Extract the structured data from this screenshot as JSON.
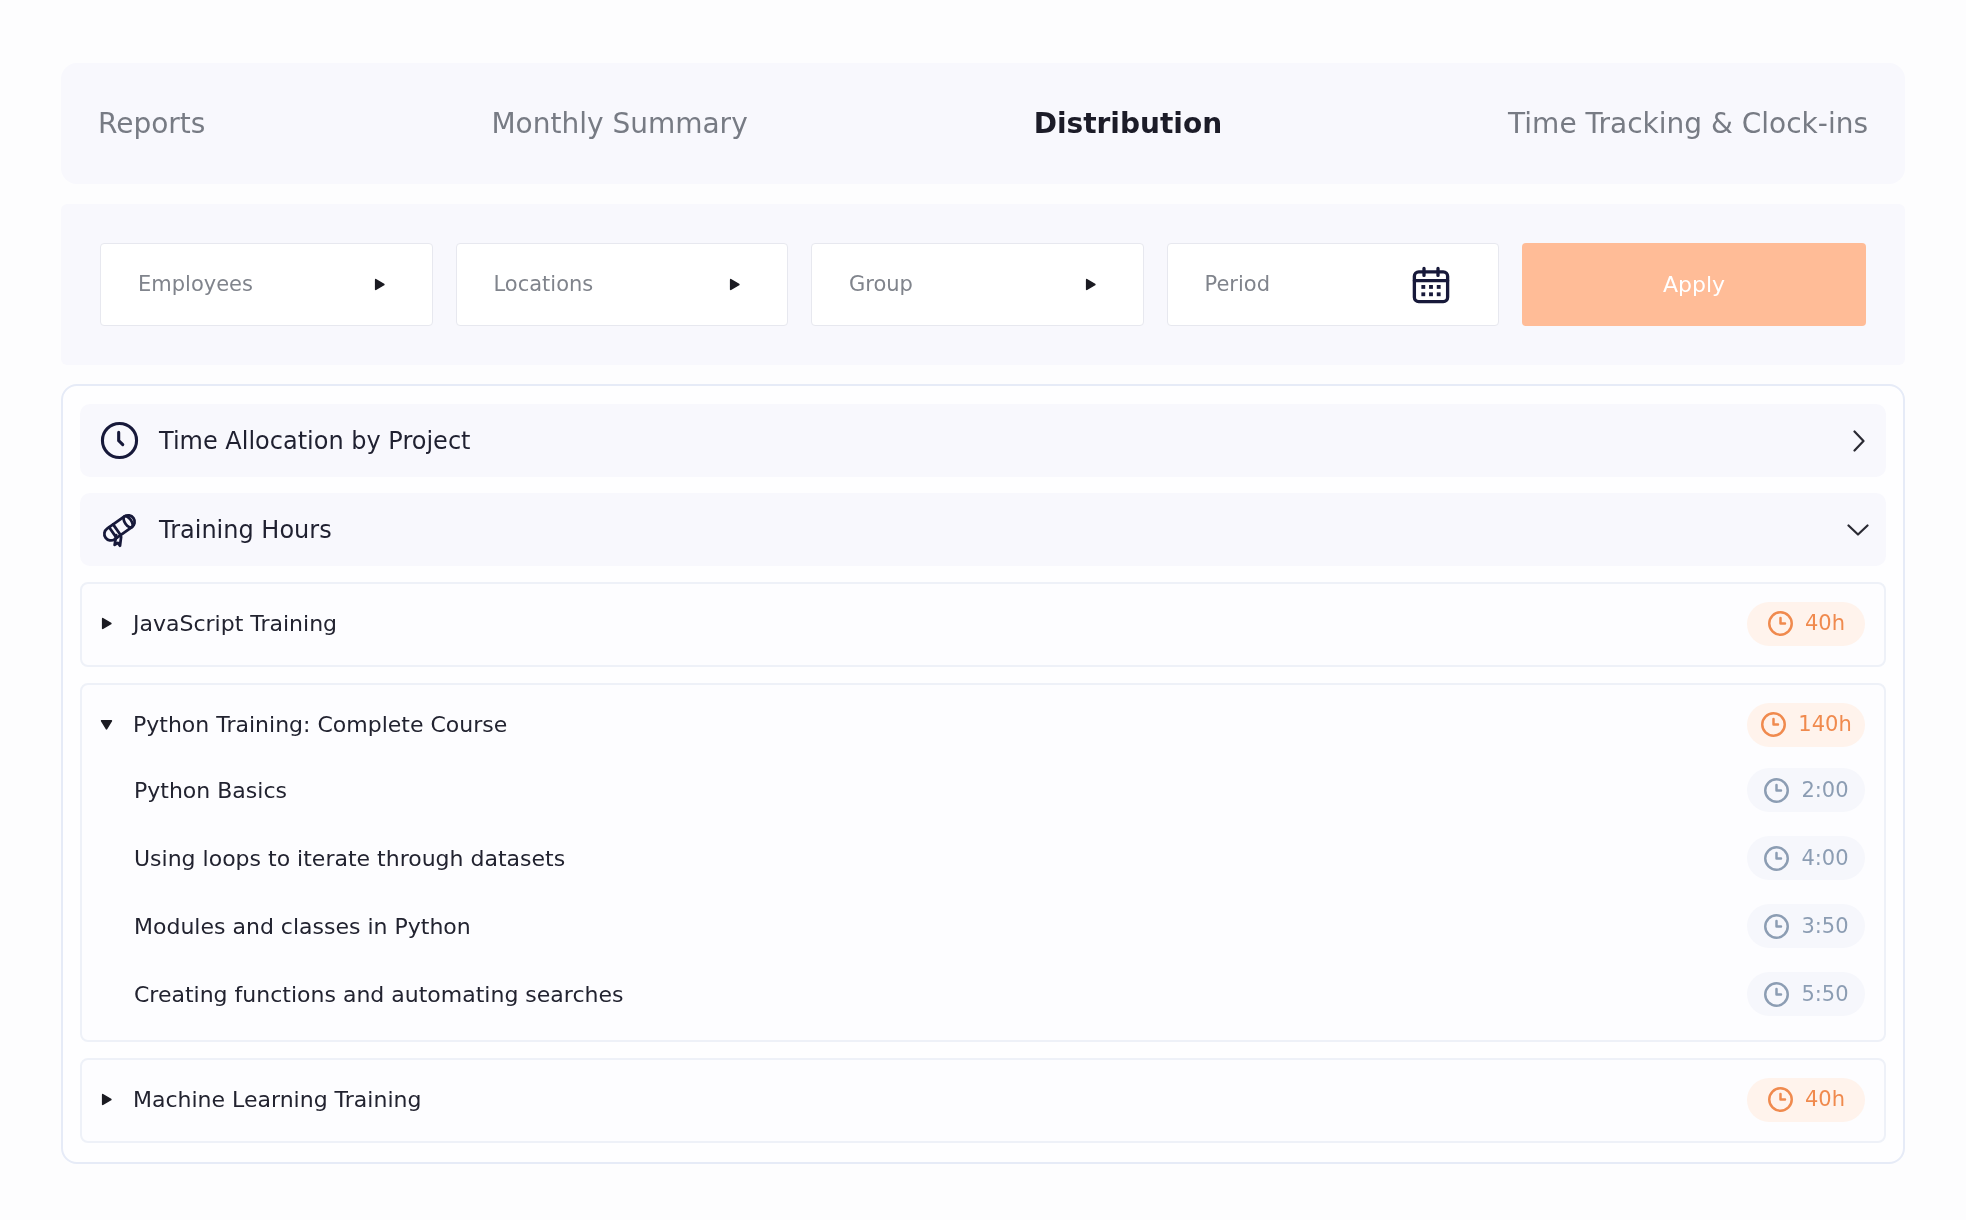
{
  "tabs": [
    {
      "label": "Reports",
      "selected": false
    },
    {
      "label": "Monthly Summary",
      "selected": false
    },
    {
      "label": "Distribution",
      "selected": true
    },
    {
      "label": "Time Tracking & Clock-ins",
      "selected": false
    }
  ],
  "filters": [
    {
      "kind": "dropdown",
      "placeholder": "Employees"
    },
    {
      "kind": "dropdown",
      "placeholder": "Locations"
    },
    {
      "kind": "dropdown",
      "placeholder": "Group"
    },
    {
      "kind": "date",
      "placeholder": "Period"
    }
  ],
  "apply_button": {
    "label": "Apply"
  },
  "sections": [
    {
      "kind": "project",
      "title": "Time Allocation by Project",
      "expanded": false
    },
    {
      "kind": "training",
      "title": "Training Hours",
      "expanded": true,
      "items": [
        {
          "title": "JavaScript Training",
          "hours": "40h",
          "expanded": false
        },
        {
          "title": "Python Training: Complete Course",
          "hours": "140h",
          "expanded": true,
          "children": [
            {
              "title": "Python Basics",
              "duration": "2:00"
            },
            {
              "title": "Using loops to iterate through datasets",
              "duration": "4:00"
            },
            {
              "title": "Modules and classes in Python",
              "duration": "3:50"
            },
            {
              "title": "Creating functions and automating searches",
              "duration": "5:50"
            }
          ]
        },
        {
          "title": "Machine Learning Training",
          "hours": "40h",
          "expanded": false
        }
      ]
    }
  ]
}
